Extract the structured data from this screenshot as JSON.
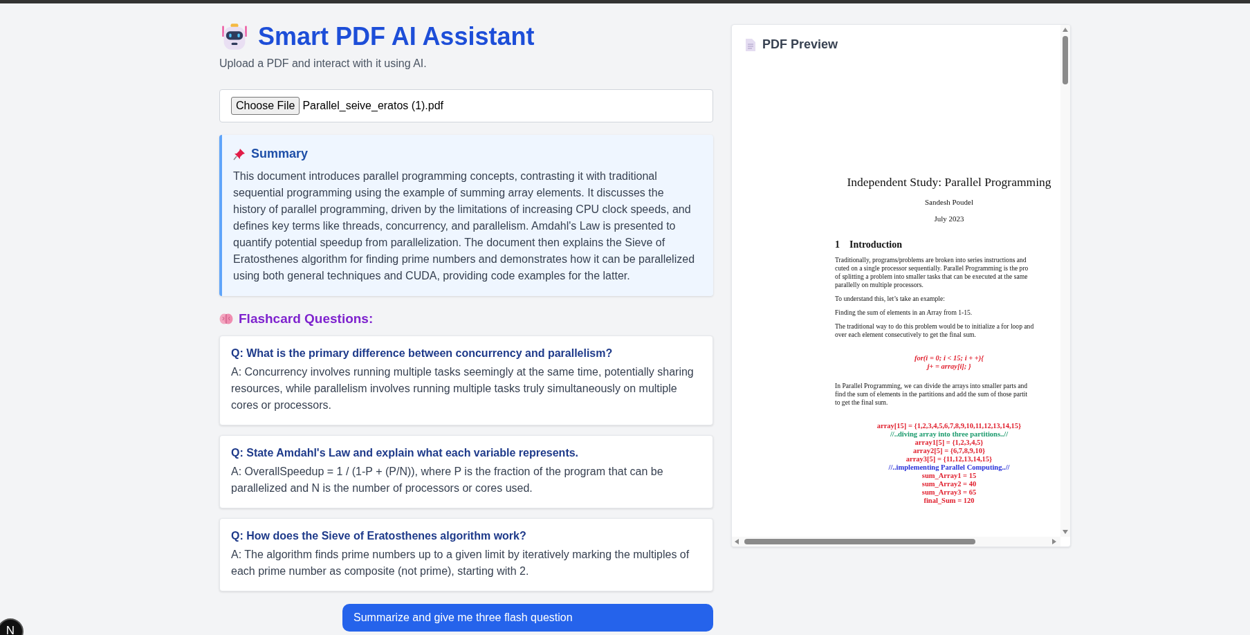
{
  "header": {
    "title": "Smart PDF AI Assistant",
    "subtitle": "Upload a PDF and interact with it using AI."
  },
  "file_input": {
    "button": "Choose File",
    "filename": "Parallel_seive_eratos (1).pdf"
  },
  "summary": {
    "title": "Summary",
    "text": "This document introduces parallel programming concepts, contrasting it with traditional sequential programming using the example of summing array elements. It discusses the history of parallel programming, driven by the limitations of increasing CPU clock speeds, and defines key terms like threads, concurrency, and parallelism. Amdahl's Law is presented to quantify potential speedup from parallelization. The document then explains the Sieve of Eratosthenes algorithm for finding prime numbers and demonstrates how it can be parallelized using both general techniques and CUDA, providing code examples for the latter."
  },
  "flashcards": {
    "title": "Flashcard Questions:",
    "items": [
      {
        "question": "Q: What is the primary difference between concurrency and parallelism?",
        "answer": "A: Concurrency involves running multiple tasks seemingly at the same time, potentially sharing resources, while parallelism involves running multiple tasks truly simultaneously on multiple cores or processors."
      },
      {
        "question": "Q: State Amdahl's Law and explain what each variable represents.",
        "answer": "A: OverallSpeedup = 1 / (1-P + (P/N)), where P is the fraction of the program that can be parallelized and N is the number of processors or cores used."
      },
      {
        "question": "Q: How does the Sieve of Eratosthenes algorithm work?",
        "answer": "A: The algorithm finds prime numbers up to a given limit by iteratively marking the multiples of each prime number as composite (not prime), starting with 2."
      }
    ]
  },
  "action_button": "Summarize and give me three flash question",
  "preview": {
    "title": "PDF Preview",
    "document": {
      "title": "Independent Study: Parallel Programming",
      "author": "Sandesh Poudel",
      "date": "July 2023",
      "section": {
        "number": "1",
        "title": "Introduction"
      },
      "blocks": [
        {
          "kind": "paragraph",
          "lines": [
            {
              "text": "Traditionally, programs/problems are broken into series instructions and"
            },
            {
              "text": "cuted on a single processor sequentially.  Parallel Programming is the pro"
            },
            {
              "text": "of splitting a problem into smaller tasks that can be executed at the same"
            },
            {
              "text": "parallelly on multiple processors."
            }
          ]
        },
        {
          "kind": "paragraph",
          "lines": [
            {
              "text": "To understand this, let’s take an example:"
            }
          ]
        },
        {
          "kind": "paragraph",
          "lines": [
            {
              "text": "Finding the sum of elements in an Array from 1-15."
            }
          ]
        },
        {
          "kind": "paragraph",
          "lines": [
            {
              "text": "The traditional way to do this problem would be to initialize a for loop and"
            },
            {
              "text": "over each element consecutively to get the final sum."
            }
          ]
        },
        {
          "kind": "formula",
          "lines": [
            {
              "text": "for(i = 0; i < 15; i + +){",
              "color": "#e0202e"
            },
            {
              "text": "j+ = array[i]; }",
              "color": "#e0202e"
            }
          ]
        },
        {
          "kind": "paragraph",
          "lines": [
            {
              "text": "In Parallel Programming, we can divide the arrays into smaller parts and"
            },
            {
              "text": "find the sum of elements in the partitions and add the sum of those partit"
            },
            {
              "text": "to get the final sum."
            }
          ]
        },
        {
          "kind": "code",
          "lines": [
            {
              "text": "array[15] = {1,2,3,4,5,6,7,8,9,10,11,12,13,14,15}",
              "color": "#e0202e"
            },
            {
              "text": "//..diving array into three partitions..//",
              "color": "#1a9a6c"
            },
            {
              "text": "array1[5] = {1,2,3,4,5}",
              "color": "#e0202e"
            },
            {
              "text": "array2[5] = {6,7,8,9,10}",
              "color": "#e0202e"
            },
            {
              "text": "array3[5] = {11,12,13,14,15}",
              "color": "#e0202e"
            },
            {
              "text": "//..implementing Parallel Computing..//",
              "color": "#2830d8"
            },
            {
              "text": "sum_Array1 = 15",
              "color": "#e0202e"
            },
            {
              "text": "sum_Array2 = 40",
              "color": "#e0202e"
            },
            {
              "text": "sum_Array3 = 65",
              "color": "#e0202e"
            },
            {
              "text": "final_Sum = 120",
              "color": "#e0202e"
            }
          ]
        }
      ]
    }
  },
  "dev_badge": "N"
}
